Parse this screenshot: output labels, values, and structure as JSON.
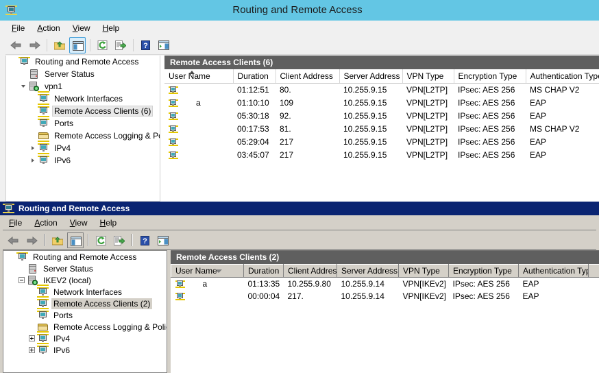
{
  "window_top": {
    "title": "Routing and Remote Access",
    "app_icon": "network-computer-icon",
    "titlebar_color": "#63c6e4",
    "menu": [
      {
        "label": "File",
        "accel": "F"
      },
      {
        "label": "Action",
        "accel": "A"
      },
      {
        "label": "View",
        "accel": "V"
      },
      {
        "label": "Help",
        "accel": "H"
      }
    ],
    "toolbar": [
      {
        "name": "back-button",
        "icon": "left-arrow-icon"
      },
      {
        "name": "forward-button",
        "icon": "right-arrow-icon"
      },
      {
        "name": "up-one-level-button",
        "icon": "folder-up-icon"
      },
      {
        "name": "show-hide-console-tree-button",
        "icon": "console-tree-icon",
        "selected": true
      },
      {
        "name": "refresh-button",
        "icon": "refresh-icon"
      },
      {
        "name": "export-list-button",
        "icon": "export-list-icon"
      },
      {
        "name": "help-button",
        "icon": "help-question-icon"
      },
      {
        "name": "show-hide-action-pane-button",
        "icon": "action-pane-icon"
      }
    ],
    "tree": [
      {
        "label": "Routing and Remote Access",
        "icon": "network-computer-icon",
        "indent": 0,
        "expander": "none",
        "selected": false
      },
      {
        "label": "Server Status",
        "icon": "server-icon",
        "indent": 1,
        "expander": "none",
        "selected": false
      },
      {
        "label": "vpn1",
        "icon": "vpn-server-icon",
        "indent": 1,
        "expander": "open",
        "selected": false
      },
      {
        "label": "Network Interfaces",
        "icon": "network-computer-icon",
        "indent": 2,
        "expander": "none",
        "selected": false
      },
      {
        "label": "Remote Access Clients (6)",
        "icon": "network-computer-icon",
        "indent": 2,
        "expander": "none",
        "selected": true
      },
      {
        "label": "Ports",
        "icon": "network-computer-icon",
        "indent": 2,
        "expander": "none",
        "selected": false
      },
      {
        "label": "Remote Access Logging & Poli",
        "icon": "folder-icon",
        "indent": 2,
        "expander": "none",
        "selected": false
      },
      {
        "label": "IPv4",
        "icon": "network-computer-icon",
        "indent": 2,
        "expander": "closed",
        "selected": false
      },
      {
        "label": "IPv6",
        "icon": "network-computer-icon",
        "indent": 2,
        "expander": "closed",
        "selected": false
      }
    ],
    "list_header": "Remote Access Clients (6)",
    "columns": [
      {
        "label": "User Name",
        "sort": "asc"
      },
      {
        "label": "Duration",
        "sort": "none"
      },
      {
        "label": "Client Address",
        "sort": "none"
      },
      {
        "label": "Server Address",
        "sort": "none"
      },
      {
        "label": "VPN Type",
        "sort": "none"
      },
      {
        "label": "Encryption Type",
        "sort": "none"
      },
      {
        "label": "Authentication Type",
        "sort": "none"
      }
    ],
    "rows": [
      {
        "icon": "client-computer-icon",
        "user_name": "",
        "duration": "01:12:51",
        "client_address": "80.",
        "server_address": "10.255.9.15",
        "vpn_type": "VPN[L2TP]",
        "encryption_type": "IPsec: AES 256",
        "authentication_type": "MS CHAP V2"
      },
      {
        "icon": "client-computer-icon",
        "user_name": "a",
        "duration": "01:10:10",
        "client_address": "109",
        "server_address": "10.255.9.15",
        "vpn_type": "VPN[L2TP]",
        "encryption_type": "IPsec: AES 256",
        "authentication_type": "EAP"
      },
      {
        "icon": "client-computer-icon",
        "user_name": "",
        "duration": "05:30:18",
        "client_address": "92.",
        "server_address": "10.255.9.15",
        "vpn_type": "VPN[L2TP]",
        "encryption_type": "IPsec: AES 256",
        "authentication_type": "EAP"
      },
      {
        "icon": "client-computer-icon",
        "user_name": "",
        "duration": "00:17:53",
        "client_address": "81.",
        "server_address": "10.255.9.15",
        "vpn_type": "VPN[L2TP]",
        "encryption_type": "IPsec: AES 256",
        "authentication_type": "MS CHAP V2"
      },
      {
        "icon": "client-computer-icon",
        "user_name": "",
        "duration": "05:29:04",
        "client_address": "217",
        "server_address": "10.255.9.15",
        "vpn_type": "VPN[L2TP]",
        "encryption_type": "IPsec: AES 256",
        "authentication_type": "EAP"
      },
      {
        "icon": "client-computer-icon",
        "user_name": "",
        "duration": "03:45:07",
        "client_address": "217",
        "server_address": "10.255.9.15",
        "vpn_type": "VPN[L2TP]",
        "encryption_type": "IPsec: AES 256",
        "authentication_type": "EAP"
      }
    ]
  },
  "window_bottom": {
    "title": "Routing and Remote Access",
    "app_icon": "network-computer-icon",
    "titlebar_color": "#0a2472",
    "menu": [
      {
        "label": "File",
        "accel": "F"
      },
      {
        "label": "Action",
        "accel": "A"
      },
      {
        "label": "View",
        "accel": "V"
      },
      {
        "label": "Help",
        "accel": "H"
      }
    ],
    "toolbar": [
      {
        "name": "back-button",
        "icon": "left-arrow-icon"
      },
      {
        "name": "forward-button",
        "icon": "right-arrow-icon"
      },
      {
        "name": "up-one-level-button",
        "icon": "folder-up-icon"
      },
      {
        "name": "show-hide-console-tree-button",
        "icon": "console-tree-icon",
        "selected": true
      },
      {
        "name": "refresh-button",
        "icon": "refresh-icon"
      },
      {
        "name": "export-list-button",
        "icon": "export-list-icon"
      },
      {
        "name": "help-button",
        "icon": "help-question-icon"
      },
      {
        "name": "show-hide-action-pane-button",
        "icon": "action-pane-icon"
      }
    ],
    "tree": [
      {
        "label": "Routing and Remote Access",
        "icon": "network-computer-icon",
        "indent": 0,
        "expander": "none",
        "selected": false
      },
      {
        "label": "Server Status",
        "icon": "server-icon",
        "indent": 1,
        "expander": "none",
        "selected": false
      },
      {
        "label": "IKEV2 (local)",
        "icon": "vpn-server-icon",
        "indent": 1,
        "expander": "minus",
        "selected": false
      },
      {
        "label": "Network Interfaces",
        "icon": "network-computer-icon",
        "indent": 2,
        "expander": "none",
        "selected": false
      },
      {
        "label": "Remote Access Clients (2)",
        "icon": "network-computer-icon",
        "indent": 2,
        "expander": "none",
        "selected": true
      },
      {
        "label": "Ports",
        "icon": "network-computer-icon",
        "indent": 2,
        "expander": "none",
        "selected": false
      },
      {
        "label": "Remote Access Logging & Policies",
        "icon": "folder-icon",
        "indent": 2,
        "expander": "none",
        "selected": false
      },
      {
        "label": "IPv4",
        "icon": "network-computer-icon",
        "indent": 2,
        "expander": "plus",
        "selected": false
      },
      {
        "label": "IPv6",
        "icon": "network-computer-icon",
        "indent": 2,
        "expander": "plus",
        "selected": false
      }
    ],
    "list_header": "Remote Access Clients (2)",
    "columns": [
      {
        "label": "User Name",
        "sort": "desc"
      },
      {
        "label": "Duration",
        "sort": "none"
      },
      {
        "label": "Client Address",
        "sort": "none"
      },
      {
        "label": "Server Address",
        "sort": "none"
      },
      {
        "label": "VPN Type",
        "sort": "none"
      },
      {
        "label": "Encryption Type",
        "sort": "none"
      },
      {
        "label": "Authentication Type",
        "sort": "none"
      }
    ],
    "rows": [
      {
        "icon": "client-computer-icon",
        "user_name": "a",
        "duration": "01:13:35",
        "client_address": "10.255.9.80",
        "server_address": "10.255.9.14",
        "vpn_type": "VPN[IKEv2]",
        "encryption_type": "IPsec: AES 256",
        "authentication_type": "EAP"
      },
      {
        "icon": "client-computer-icon",
        "user_name": "",
        "duration": "00:00:04",
        "client_address": "217.",
        "server_address": "10.255.9.14",
        "vpn_type": "VPN[IKEv2]",
        "encryption_type": "IPsec: AES 256",
        "authentication_type": "EAP"
      }
    ]
  }
}
